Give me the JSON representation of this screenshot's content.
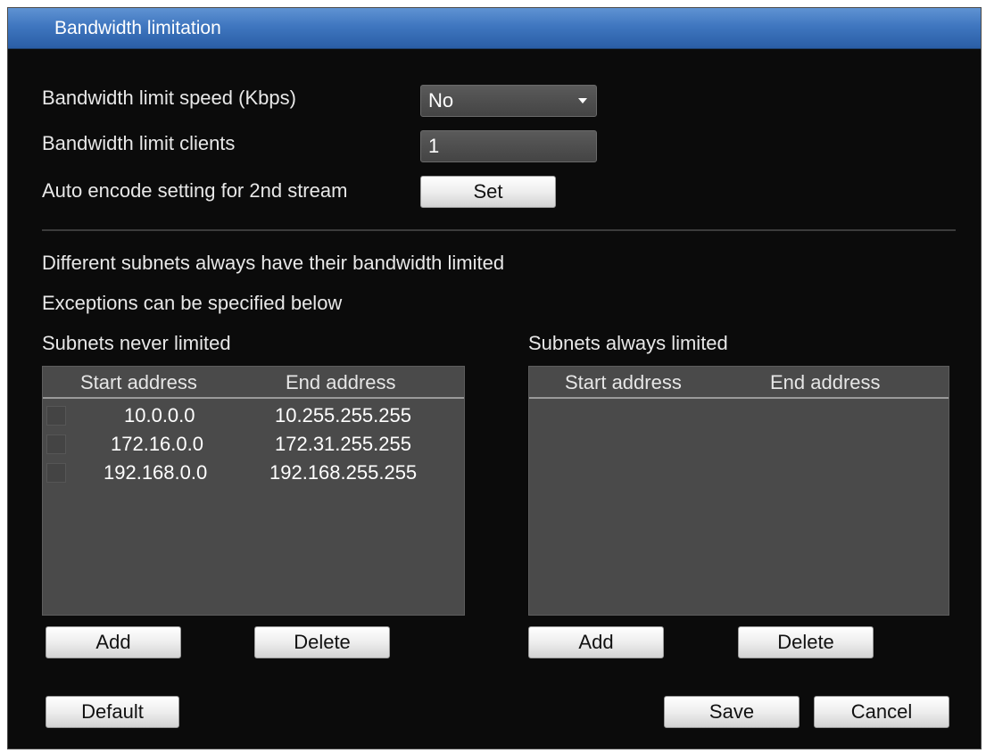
{
  "window": {
    "title": "Bandwidth limitation"
  },
  "settings": {
    "speed_label": "Bandwidth limit speed  (Kbps)",
    "speed_value": "No",
    "clients_label": "Bandwidth limit clients",
    "clients_value": "1",
    "encode_label": "Auto encode setting for 2nd stream",
    "set_label": "Set"
  },
  "info": {
    "line1": "Different subnets always have their bandwidth limited",
    "line2": "Exceptions can be specified below"
  },
  "never_limited": {
    "title": "Subnets never limited",
    "columns": [
      "Start address",
      "End address"
    ],
    "rows": [
      {
        "start": "10.0.0.0",
        "end": "10.255.255.255"
      },
      {
        "start": "172.16.0.0",
        "end": "172.31.255.255"
      },
      {
        "start": "192.168.0.0",
        "end": "192.168.255.255"
      }
    ],
    "add_label": "Add",
    "delete_label": "Delete"
  },
  "always_limited": {
    "title": "Subnets always limited",
    "columns": [
      "Start address",
      "End address"
    ],
    "rows": [],
    "add_label": "Add",
    "delete_label": "Delete"
  },
  "footer": {
    "default_label": "Default",
    "save_label": "Save",
    "cancel_label": "Cancel"
  },
  "colors": {
    "title_bar": "#3f76bf",
    "background": "#0b0b0b",
    "grid": "#4a4a4a"
  }
}
